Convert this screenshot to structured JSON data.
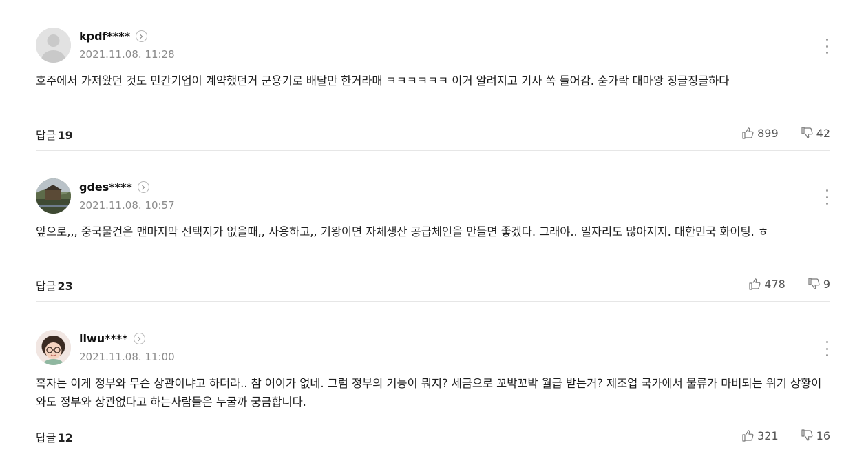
{
  "comments": [
    {
      "username": "kpdf****",
      "date": "2021.11.08. 11:28",
      "text": "호주에서 가져왔던 것도 민간기업이 계약했던거 군용기로 배달만 한거라매 ㅋㅋㅋㅋㅋㅋ 이거 알려지고 기사 쏙 들어감. 숟가락 대마왕 징글징글하다",
      "reply_label": "답글",
      "reply_count": "19",
      "likes": "899",
      "dislikes": "42",
      "avatar": "default-avatar"
    },
    {
      "username": "gdes****",
      "date": "2021.11.08. 10:57",
      "text": "앞으로,,, 중국물건은 맨마지막 선택지가 없을때,, 사용하고,, 기왕이면 자체생산 공급체인을 만들면 좋겠다. 그래야.. 일자리도 많아지지. 대한민국 화이팅. ㅎ",
      "reply_label": "답글",
      "reply_count": "23",
      "likes": "478",
      "dislikes": "9",
      "avatar": "landscape-photo"
    },
    {
      "username": "ilwu****",
      "date": "2021.11.08. 11:00",
      "text": "혹자는 이게 정부와 무슨 상관이냐고 하더라.. 참 어이가 없네. 그럼 정부의 기능이 뭐지? 세금으로 꼬박꼬박 월급 받는거? 제조업 국가에서 물류가 마비되는 위기 상황이 와도 정부와 상관없다고 하는사람들은 누굴까 궁금합니다.",
      "reply_label": "답글",
      "reply_count": "12",
      "likes": "321",
      "dislikes": "16",
      "avatar": "cartoon-person"
    }
  ],
  "icons": {
    "profile_link": "chevron-right-circle-icon",
    "more": "vertical-ellipsis-icon",
    "like": "thumbs-up-icon",
    "dislike": "thumbs-down-icon"
  },
  "colors": {
    "text": "#1e1e1e",
    "meta": "#8b8b8b",
    "divider": "#e6e6e6"
  }
}
